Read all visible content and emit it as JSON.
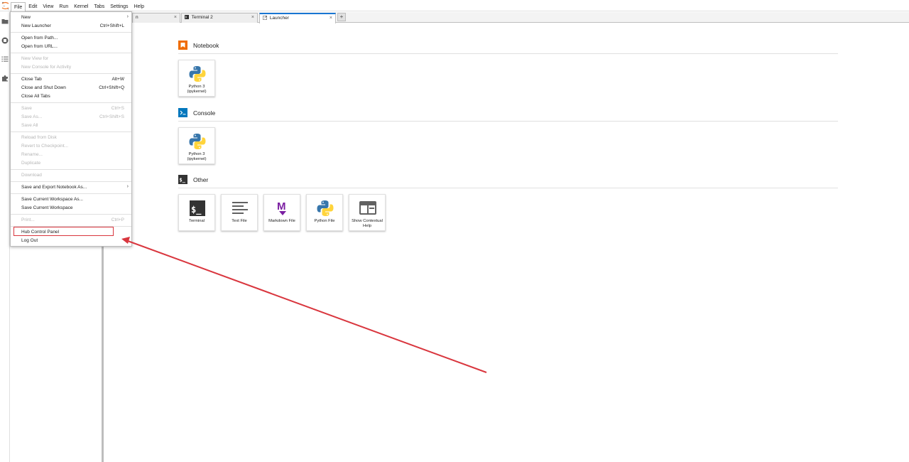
{
  "menubar": {
    "items": [
      "File",
      "Edit",
      "View",
      "Run",
      "Kernel",
      "Tabs",
      "Settings",
      "Help"
    ]
  },
  "tabs": [
    {
      "label": "n",
      "icon": "notebook-icon"
    },
    {
      "label": "Terminal 2",
      "icon": "terminal-icon"
    },
    {
      "label": "Launcher",
      "icon": "launcher-icon"
    }
  ],
  "tab_close_glyph": "×",
  "tab_add_glyph": "+",
  "file_menu": {
    "new": {
      "label": "New",
      "arrow": "›"
    },
    "new_launcher": {
      "label": "New Launcher",
      "shortcut": "Ctrl+Shift+L"
    },
    "open_from_path": {
      "label": "Open from Path..."
    },
    "open_from_url": {
      "label": "Open from URL..."
    },
    "new_view_for": {
      "label": "New View for"
    },
    "new_console_for_activity": {
      "label": "New Console for Activity"
    },
    "close_tab": {
      "label": "Close Tab",
      "shortcut": "Alt+W"
    },
    "close_and_shut_down": {
      "label": "Close and Shut Down",
      "shortcut": "Ctrl+Shift+Q"
    },
    "close_all_tabs": {
      "label": "Close All Tabs"
    },
    "save": {
      "label": "Save",
      "shortcut": "Ctrl+S"
    },
    "save_as": {
      "label": "Save As...",
      "shortcut": "Ctrl+Shift+S"
    },
    "save_all": {
      "label": "Save All"
    },
    "reload_from_disk": {
      "label": "Reload from Disk"
    },
    "revert_to_checkpoint": {
      "label": "Revert to Checkpoint..."
    },
    "rename": {
      "label": "Rename..."
    },
    "duplicate": {
      "label": "Duplicate"
    },
    "download": {
      "label": "Download"
    },
    "save_and_export": {
      "label": "Save and Export Notebook As...",
      "arrow": "›"
    },
    "save_workspace_as": {
      "label": "Save Current Workspace As..."
    },
    "save_workspace": {
      "label": "Save Current Workspace"
    },
    "print": {
      "label": "Print...",
      "shortcut": "Ctrl+P"
    },
    "hub_control_panel": {
      "label": "Hub Control Panel"
    },
    "log_out": {
      "label": "Log Out"
    }
  },
  "launcher": {
    "notebook": {
      "title": "Notebook",
      "cards": [
        {
          "label": "Python 3 (ipykernel)",
          "icon": "python-icon"
        }
      ]
    },
    "console": {
      "title": "Console",
      "cards": [
        {
          "label": "Python 3 (ipykernel)",
          "icon": "python-icon"
        }
      ]
    },
    "other": {
      "title": "Other",
      "cards": [
        {
          "label": "Terminal",
          "icon": "terminal-icon"
        },
        {
          "label": "Text File",
          "icon": "text-file-icon"
        },
        {
          "label": "Markdown File",
          "icon": "markdown-icon"
        },
        {
          "label": "Python File",
          "icon": "python-icon"
        },
        {
          "label": "Show Contextual Help",
          "icon": "contextual-help-icon"
        }
      ]
    }
  },
  "colors": {
    "accent": "#1976d2",
    "notebook_orange": "#ef6c00",
    "console_blue": "#0277bd",
    "markdown_purple": "#7b1fa2",
    "annotation_red": "#d9363e"
  }
}
